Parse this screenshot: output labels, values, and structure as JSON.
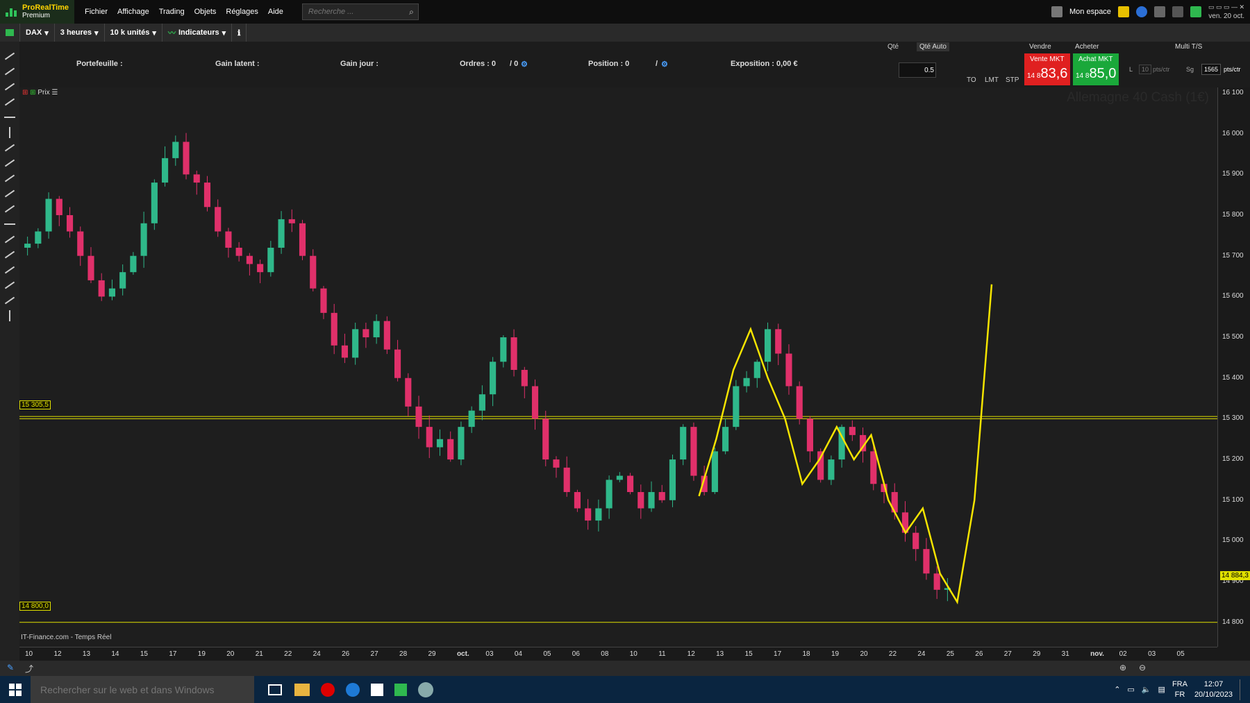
{
  "app": {
    "brand_line1": "ProRealTime",
    "brand_line2": "Premium"
  },
  "menu": [
    "Fichier",
    "Affichage",
    "Trading",
    "Objets",
    "Réglages",
    "Aide"
  ],
  "search": {
    "placeholder": "Recherche ..."
  },
  "top_right": {
    "workspace": "Mon espace",
    "date": "ven. 20 oct."
  },
  "toolbar": {
    "instrument": "DAX",
    "timeframe": "3 heures",
    "units": "10 k unités",
    "indicators": "Indicateurs"
  },
  "infobar": {
    "portfolio": "Portefeuille :",
    "latent": "Gain latent :",
    "day_gain": "Gain jour :",
    "orders": "Ordres : 0",
    "orders_sep": "/ 0",
    "position": "Position : 0",
    "position_sep": "/",
    "exposure": "Exposition : 0,00 €"
  },
  "order_panel": {
    "qty_label": "Qté",
    "qty_auto": "Qté Auto",
    "qty_value": "0.5",
    "to": "TO",
    "lmt": "LMT",
    "stp": "STP",
    "sell_header": "Vendre",
    "buy_header": "Acheter",
    "sell_label": "Vente MKT",
    "sell_price_small": "14 8",
    "sell_price_big": "83,6",
    "buy_label": "Achat MKT",
    "buy_price_small": "14 8",
    "buy_price_big": "85,0",
    "multi": "Multi T/S",
    "l_label": "L",
    "l_value": "10",
    "pts_ctr": "pts/ctr",
    "sg_label": "Sg",
    "sg_value": "1565",
    "pts_ctr2": "pts/ctr"
  },
  "chart": {
    "price_label": "Prix",
    "watermark": "Allemagne 40 Cash (1€)",
    "source": "IT-Finance.com - Temps Réel",
    "hline_upper": "15 305,5",
    "hline_lower": "14 800,0",
    "current_price_tag": "14 884,3"
  },
  "chart_data": {
    "type": "candlestick",
    "y_ticks": [
      "16 100",
      "16 000",
      "15 900",
      "15 800",
      "15 700",
      "15 600",
      "15 500",
      "15 400",
      "15 300",
      "15 200",
      "15 100",
      "15 000",
      "14 900",
      "14 800"
    ],
    "x_ticks": [
      "10",
      "12",
      "13",
      "14",
      "15",
      "17",
      "19",
      "20",
      "21",
      "22",
      "24",
      "26",
      "27",
      "28",
      "29",
      "oct.",
      "03",
      "04",
      "05",
      "06",
      "08",
      "10",
      "11",
      "12",
      "13",
      "15",
      "17",
      "18",
      "19",
      "20",
      "22",
      "24",
      "25",
      "26",
      "27",
      "29",
      "31",
      "nov.",
      "02",
      "03",
      "05"
    ],
    "ylim": [
      14740,
      16100
    ],
    "closes": [
      15730,
      15760,
      15840,
      15800,
      15760,
      15700,
      15640,
      15600,
      15620,
      15660,
      15700,
      15780,
      15880,
      15940,
      15980,
      15900,
      15880,
      15820,
      15760,
      15720,
      15700,
      15680,
      15660,
      15720,
      15790,
      15780,
      15700,
      15620,
      15560,
      15480,
      15450,
      15520,
      15500,
      15540,
      15470,
      15400,
      15330,
      15280,
      15230,
      15250,
      15200,
      15280,
      15320,
      15360,
      15440,
      15500,
      15420,
      15380,
      15300,
      15200,
      15180,
      15120,
      15080,
      15050,
      15080,
      15150,
      15160,
      15120,
      15080,
      15120,
      15100,
      15200,
      15280,
      15160,
      15120,
      15220,
      15280,
      15380,
      15400,
      15440,
      15520,
      15460,
      15380,
      15300,
      15220,
      15150,
      15200,
      15280,
      15260,
      15220,
      15140,
      15120,
      15070,
      15020,
      14980,
      14920,
      14880,
      14884
    ],
    "horizontal_lines": [
      15305.5,
      15300,
      14800
    ],
    "drawn_path": [
      [
        15110,
        15250,
        15420,
        15520,
        15400,
        15300,
        15140,
        15200,
        15280,
        15200,
        15260,
        15100,
        15020,
        15080,
        14920,
        14850,
        15100,
        15630
      ]
    ]
  },
  "taskbar": {
    "search_placeholder": "Rechercher sur le web et dans Windows",
    "lang1": "FRA",
    "lang2": "FR",
    "time": "12:07",
    "date": "20/10/2023"
  }
}
